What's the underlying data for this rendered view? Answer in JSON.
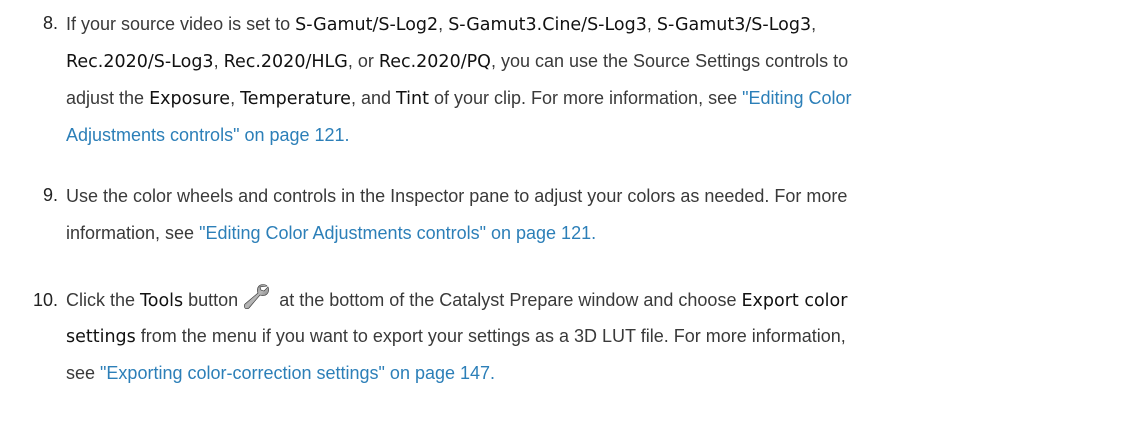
{
  "link_color": "#2c7fb8",
  "steps": [
    {
      "number": "8.",
      "l1_a": "If your source video is set to ",
      "l1_ui1": "S-Gamut/S-Log2",
      "l1_b": ", ",
      "l1_ui2": "S-Gamut3.Cine/S-Log3",
      "l1_c": ", ",
      "l1_ui3": "S-Gamut3/S-Log3",
      "l1_d": ",",
      "l2_ui1": "Rec.2020/S-Log3",
      "l2_a": ", ",
      "l2_ui2": "Rec.2020/HLG",
      "l2_b": ", or ",
      "l2_ui3": "Rec.2020/PQ",
      "l2_c": ", you can use the Source Settings controls to",
      "l3_a": "adjust the ",
      "l3_ui1": "Exposure",
      "l3_b": ", ",
      "l3_ui2": "Temperature",
      "l3_c": ", and ",
      "l3_ui3": "Tint",
      "l3_d": " of your clip. For more information, see ",
      "l3_link": "\"Editing Color",
      "l4_link": "Adjustments controls\" on page 121."
    },
    {
      "number": "9.",
      "l1": "Use the color wheels and controls in the Inspector pane to adjust your colors as needed. For more",
      "l2_a": "information, see ",
      "l2_link": "\"Editing Color Adjustments controls\" on page 121."
    },
    {
      "number": "10.",
      "l1_a": "Click the ",
      "l1_ui1": "Tools",
      "l1_b": " button",
      "icon": "wrench-icon",
      "l1_c": " at the bottom of the Catalyst Prepare window and choose ",
      "l1_ui2": "Export color",
      "l2_ui1": "settings",
      "l2_a": " from the menu if you want to export your settings as a 3D LUT file. For more information,",
      "l3_a": "see ",
      "l3_link": "\"Exporting color-correction settings\" on page 147."
    }
  ]
}
